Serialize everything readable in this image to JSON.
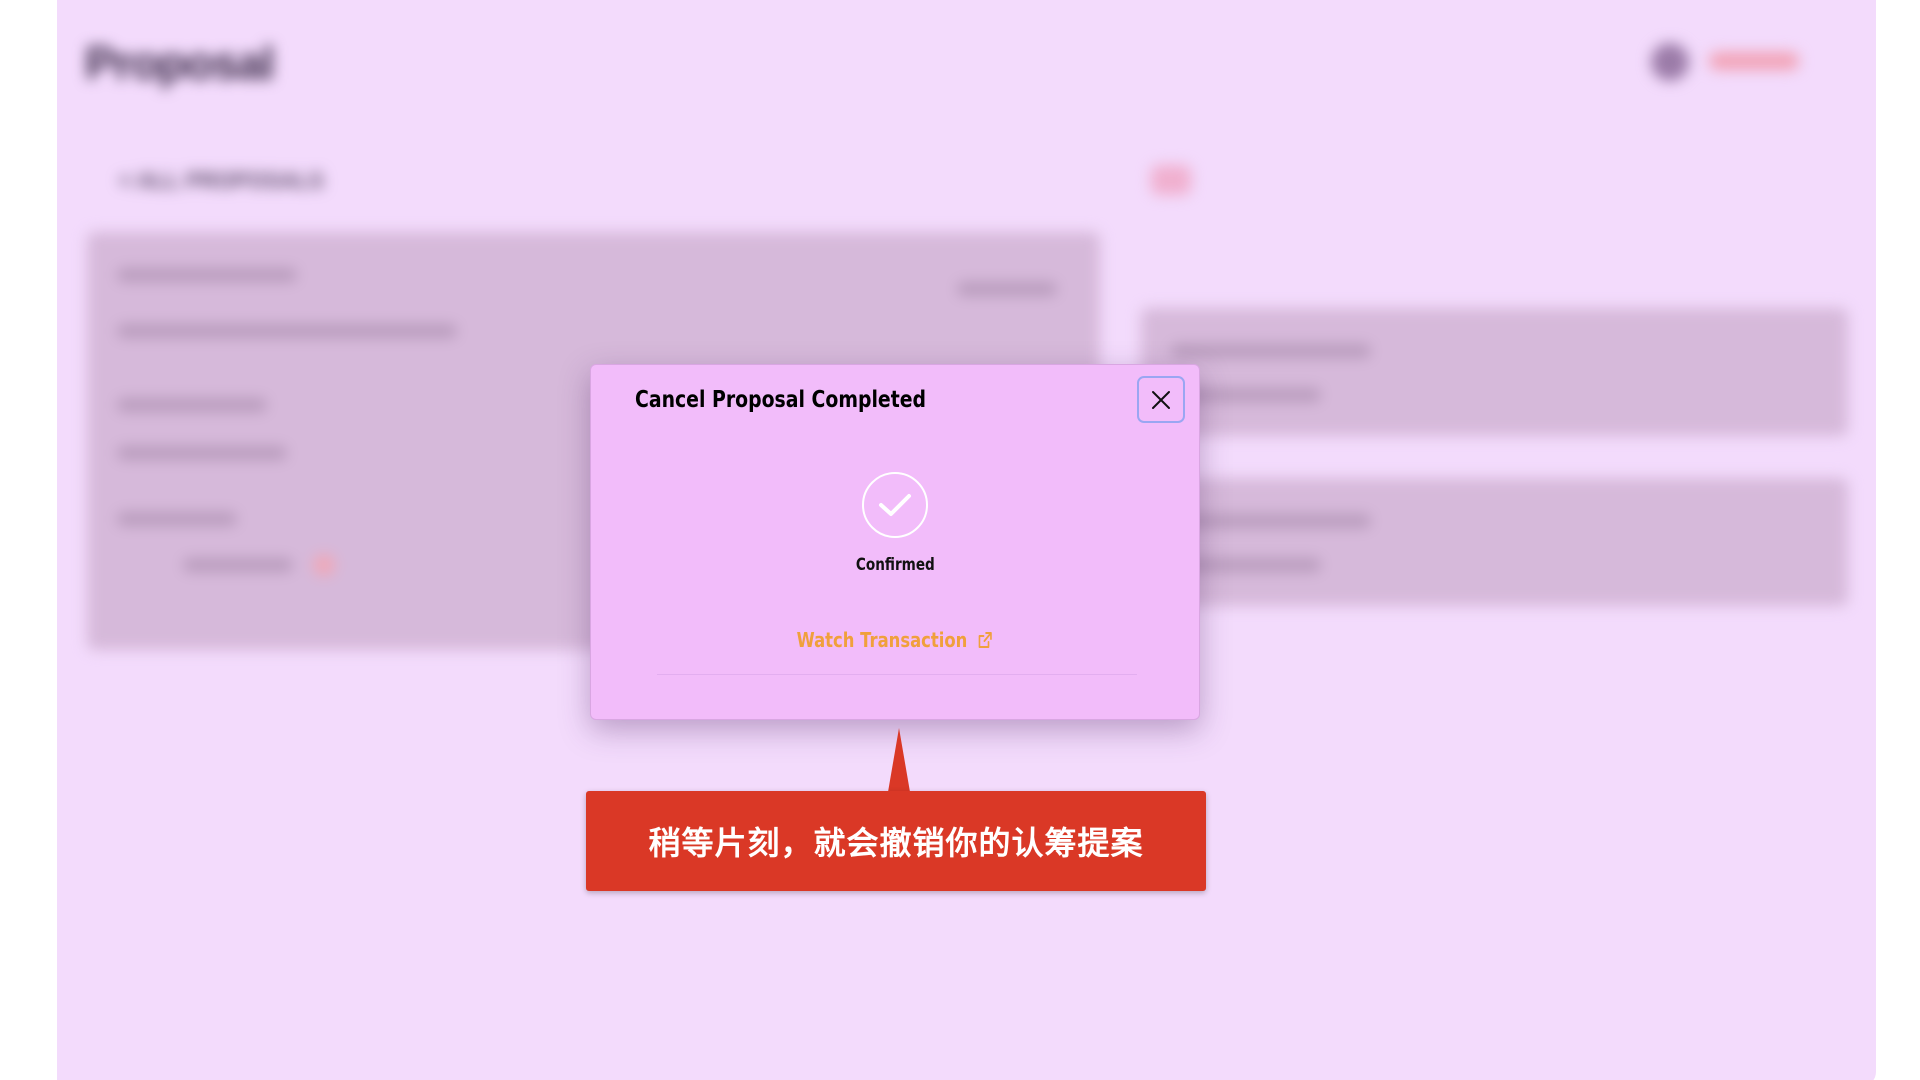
{
  "background": {
    "page_title": "Proposal",
    "back_link": "< ALL PROPOSALS"
  },
  "modal": {
    "title": "Cancel Proposal Completed",
    "status": "Confirmed",
    "link_label": "Watch Transaction",
    "close_icon": "close-icon",
    "status_icon": "check-circle-icon",
    "link_icon": "external-link-icon",
    "background_color": "#f2bcfa",
    "link_color": "#f0a03c"
  },
  "callout": {
    "text": "稍等片刻，就会撤销你的认筹提案",
    "color": "#da3826"
  }
}
